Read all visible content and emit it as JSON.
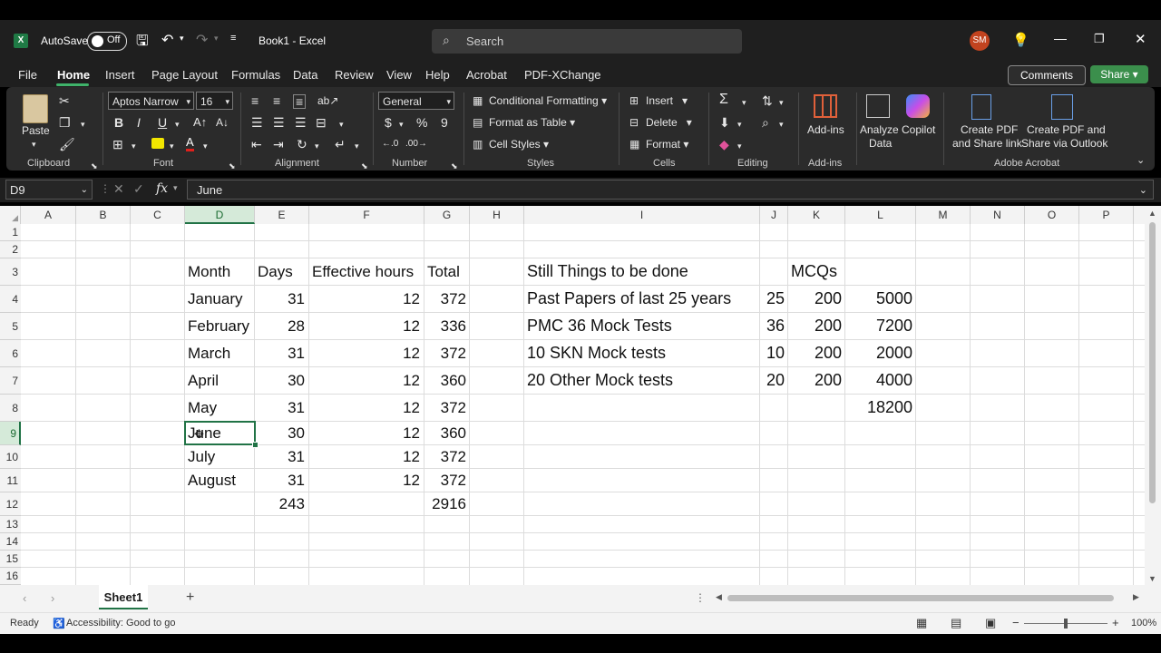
{
  "titlebar": {
    "autosave_label": "AutoSave",
    "autosave_state": "Off",
    "filename": "Book1",
    "separator": "-",
    "app": "Excel",
    "search_placeholder": "Search",
    "avatar_initials": "SM"
  },
  "menu": {
    "items": [
      "File",
      "Home",
      "Insert",
      "Page Layout",
      "Formulas",
      "Data",
      "Review",
      "View",
      "Help",
      "Acrobat",
      "PDF-XChange"
    ],
    "active": "Home",
    "comments": "Comments",
    "share": "Share"
  },
  "ribbon": {
    "clipboard": {
      "paste": "Paste",
      "group": "Clipboard"
    },
    "font": {
      "family": "Aptos Narrow",
      "size": "16",
      "group": "Font"
    },
    "alignment": {
      "group": "Alignment"
    },
    "number": {
      "format": "General",
      "currency": "$",
      "percent": "%",
      "comma": "9",
      "group": "Number"
    },
    "styles": {
      "conditional": "Conditional Formatting",
      "format_table": "Format as Table",
      "cell_styles": "Cell Styles",
      "group": "Styles"
    },
    "cells": {
      "insert": "Insert",
      "delete": "Delete",
      "format": "Format",
      "group": "Cells"
    },
    "editing": {
      "group": "Editing"
    },
    "addins": {
      "label": "Add-ins",
      "group": "Add-ins"
    },
    "analyze": {
      "label1": "Analyze",
      "label2": "Data"
    },
    "copilot": "Copilot",
    "acrobat": {
      "create1_a": "Create PDF",
      "create1_b": "and Share link",
      "create2_a": "Create PDF and",
      "create2_b": "Share via Outlook",
      "group": "Adobe Acrobat"
    }
  },
  "formula_bar": {
    "name_box": "D9",
    "fx": "fx",
    "content": "June"
  },
  "columns": [
    "A",
    "B",
    "C",
    "D",
    "E",
    "F",
    "G",
    "H",
    "I",
    "J",
    "K",
    "L",
    "M",
    "N",
    "O",
    "P"
  ],
  "selected_column": "D",
  "rows": [
    "1",
    "2",
    "3",
    "4",
    "5",
    "6",
    "7",
    "8",
    "9",
    "10",
    "11",
    "12",
    "13",
    "14",
    "15",
    "16"
  ],
  "selected_row": "9",
  "months_table": {
    "headers": {
      "month": "Month",
      "days": "Days",
      "hours": "Effective hours",
      "total": "Total"
    },
    "rows": [
      {
        "month": "January",
        "days": "31",
        "hours": "12",
        "total": "372"
      },
      {
        "month": "February",
        "days": "28",
        "hours": "12",
        "total": "336"
      },
      {
        "month": "March",
        "days": "31",
        "hours": "12",
        "total": "372"
      },
      {
        "month": "April",
        "days": "30",
        "hours": "12",
        "total": "360"
      },
      {
        "month": "May",
        "days": "31",
        "hours": "12",
        "total": "372"
      },
      {
        "month": "June",
        "days": "30",
        "hours": "12",
        "total": "360"
      },
      {
        "month": "July",
        "days": "31",
        "hours": "12",
        "total": "372"
      },
      {
        "month": "August",
        "days": "31",
        "hours": "12",
        "total": "372"
      }
    ],
    "sum_days": "243",
    "sum_total": "2916"
  },
  "todo_table": {
    "header": "Still Things to be done",
    "mcq_header": "MCQs",
    "rows": [
      {
        "task": "Past Papers of last 25 years",
        "count": "25",
        "mcqs": "200",
        "total": "5000"
      },
      {
        "task": "PMC 36 Mock Tests",
        "count": "36",
        "mcqs": "200",
        "total": "7200"
      },
      {
        "task": "10 SKN Mock tests",
        "count": "10",
        "mcqs": "200",
        "total": "2000"
      },
      {
        "task": "20 Other Mock tests",
        "count": "20",
        "mcqs": "200",
        "total": "4000"
      }
    ],
    "grand_total": "18200"
  },
  "sheet_tabs": {
    "active": "Sheet1"
  },
  "status": {
    "ready": "Ready",
    "accessibility": "Accessibility: Good to go",
    "zoom": "100%"
  },
  "colors": {
    "excel_green": "#217346",
    "share_green": "#3b8f4c",
    "avatar": "#c2431f"
  }
}
